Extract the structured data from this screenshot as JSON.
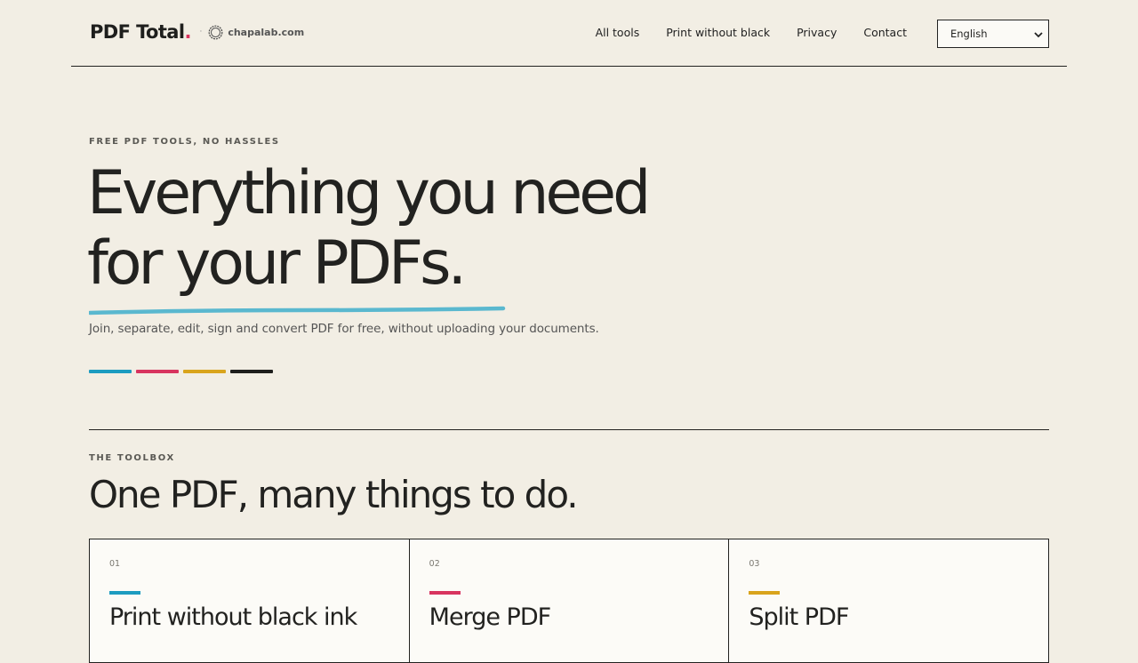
{
  "header": {
    "brand_name": "PDF Total",
    "brand_dot": ".",
    "separator": "·",
    "partner": "chapalab.com",
    "nav": [
      "All tools",
      "Print without black",
      "Privacy",
      "Contact"
    ],
    "language": "English"
  },
  "hero": {
    "eyebrow": "FREE PDF TOOLS, NO HASSLES",
    "title_line1": "Everything you need",
    "title_line2": "for your PDFs.",
    "subtitle": "Join, separate, edit, sign and convert PDF for free, without uploading your documents.",
    "swatch_colors": [
      "#1d9cc0",
      "#d8345f",
      "#d9a41c",
      "#1e1e1c"
    ]
  },
  "toolbox": {
    "eyebrow": "THE TOOLBOX",
    "title": "One PDF, many things to do.",
    "cards": [
      {
        "num": "01",
        "title": "Print without black ink",
        "color": "#1d9cc0"
      },
      {
        "num": "02",
        "title": "Merge PDF",
        "color": "#d8345f"
      },
      {
        "num": "03",
        "title": "Split PDF",
        "color": "#d9a41c"
      }
    ]
  },
  "colors": {
    "background": "#f2eee4",
    "ink": "#222220",
    "underline": "#5ab8cf",
    "accent_red": "#d8345f"
  }
}
